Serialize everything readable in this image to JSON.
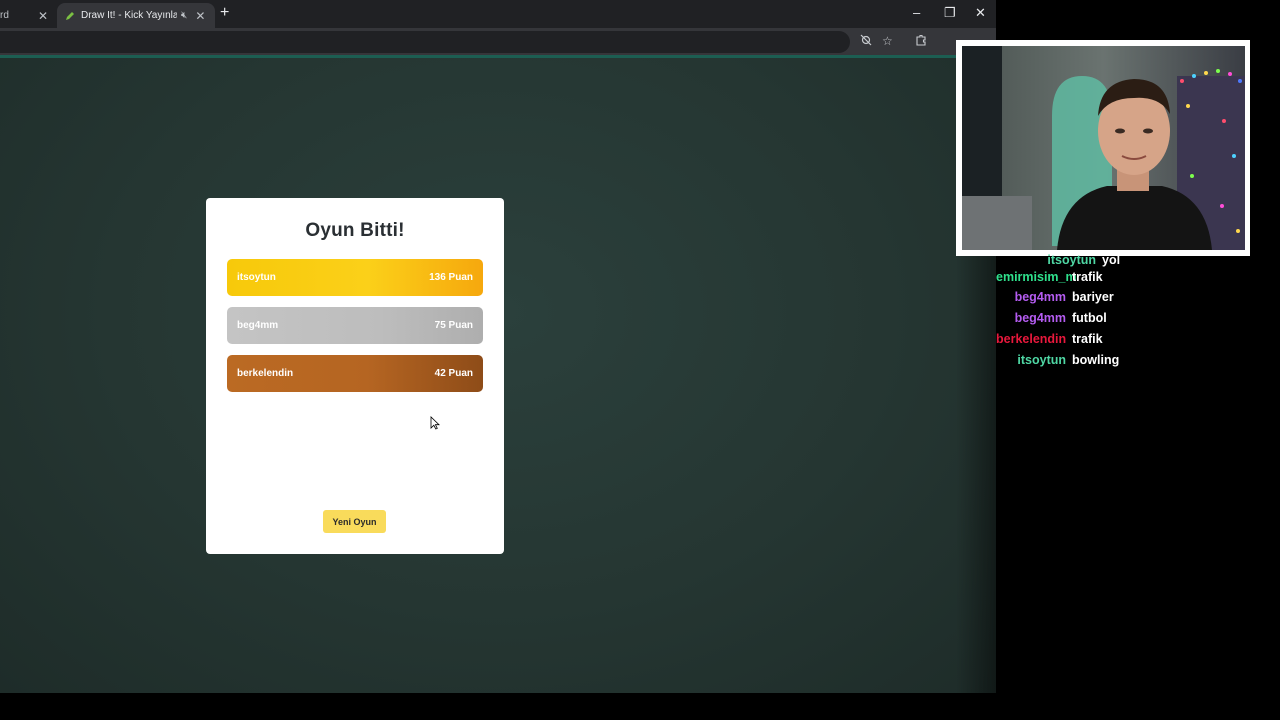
{
  "browser": {
    "tabs": [
      {
        "label": "rd",
        "active": false
      },
      {
        "label": "Draw It! - Kick Yayınları İçin",
        "active": true,
        "muted": true
      }
    ],
    "colors": {
      "chrome": "#202124",
      "toolbar": "#35363a",
      "page_bg": "#253632"
    }
  },
  "game": {
    "title": "Oyun Bitti!",
    "results": [
      {
        "rank": 1,
        "name": "itsoytun",
        "points": "136 Puan",
        "color": "#f7c90a"
      },
      {
        "rank": 2,
        "name": "beg4mm",
        "points": "75 Puan",
        "color": "#bdbdbd"
      },
      {
        "rank": 3,
        "name": "berkelendin",
        "points": "42 Puan",
        "color": "#b56522"
      }
    ],
    "new_game_label": "Yeni Oyun",
    "accent": "#f9db5b"
  },
  "chat": {
    "messages": [
      {
        "user": "itsoytun",
        "text": "yol",
        "color": "#4fd7a4"
      },
      {
        "user": "emirmisim_m",
        "text": "trafik",
        "color": "#2fe08c"
      },
      {
        "user": "beg4mm",
        "text": "bariyer",
        "color": "#b45cf0"
      },
      {
        "user": "beg4mm",
        "text": "futbol",
        "color": "#b45cf0"
      },
      {
        "user": "berkelendin",
        "text": "trafik",
        "color": "#e8183c"
      },
      {
        "user": "itsoytun",
        "text": "bowling",
        "color": "#4fd7a4"
      }
    ]
  }
}
